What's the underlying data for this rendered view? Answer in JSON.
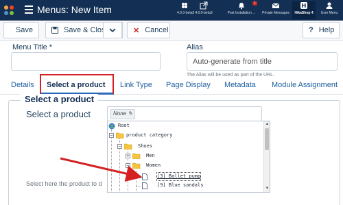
{
  "topbar": {
    "title": "Menus: New Item",
    "items": [
      {
        "label": "4.0.0-beta3",
        "icon": "joomla-icon"
      },
      {
        "label": "4.0.0-beta3",
        "icon": "external-link-icon"
      },
      {
        "label": "Post Installation ...",
        "icon": "bell-icon",
        "badge": "1"
      },
      {
        "label": "Private Messages",
        "icon": "envelope-icon"
      },
      {
        "label": "HikaShop 4",
        "icon": "hikashop-icon"
      },
      {
        "label": "User Menu",
        "icon": "user-icon"
      }
    ]
  },
  "toolbar": {
    "save": "Save",
    "save_close": "Save & Close",
    "cancel": "Cancel",
    "help": "Help"
  },
  "form": {
    "menu_title_label": "Menu Title *",
    "menu_title_value": "",
    "alias_label": "Alias",
    "alias_placeholder": "Auto-generate from title",
    "alias_hint": "The Alias will be used as part of the URL."
  },
  "tabs": [
    "Details",
    "Select a product",
    "Link Type",
    "Page Display",
    "Metadata",
    "Module Assignment"
  ],
  "product": {
    "legend": "Select a product",
    "label": "Select a product",
    "selected": "None",
    "help_text": "Select here the product to d"
  },
  "tree": {
    "root": "Root",
    "category": "product category",
    "shoes": "Shoes",
    "men": "Men",
    "women": "Women",
    "item1": "[3] Ballet pump",
    "item2": "[9] Blue sandals"
  },
  "colors": {
    "topbar": "#132f53",
    "annotation_red": "#d42020",
    "active_tab_underline": "#2a69b8"
  }
}
